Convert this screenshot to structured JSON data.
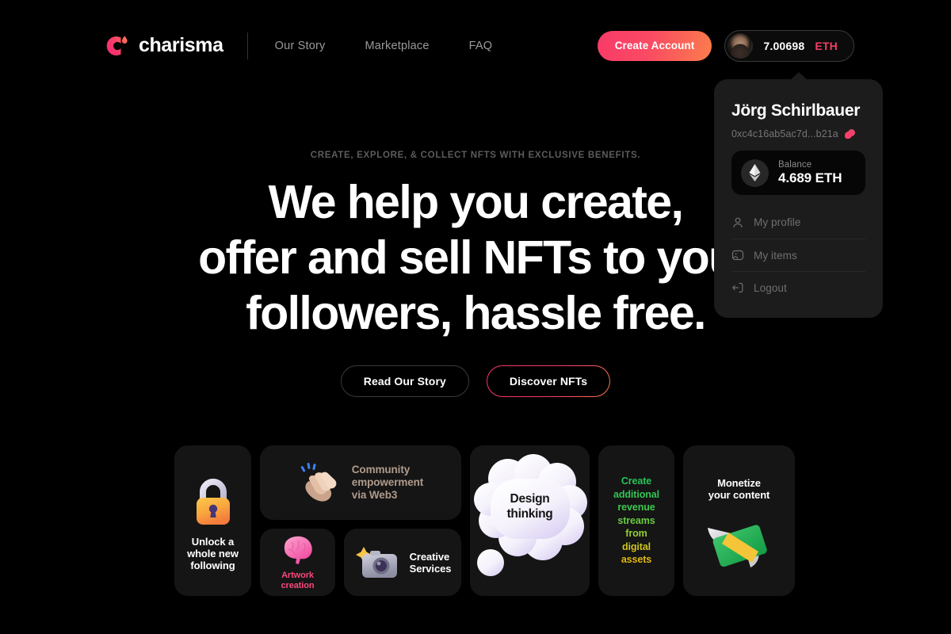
{
  "header": {
    "brand": {
      "name": "charisma",
      "logo_icon": "charisma-c-logo"
    },
    "nav": [
      {
        "label": "Our Story"
      },
      {
        "label": "Marketplace"
      },
      {
        "label": "FAQ"
      }
    ],
    "create_account_label": "Create Account",
    "wallet": {
      "amount": "7.00698",
      "unit": "ETH",
      "avatar_icon": "user-avatar"
    }
  },
  "dropdown": {
    "name": "Jörg Schirlbauer",
    "address": "0xc4c16ab5ac7d...b21a",
    "copy_icon": "copy-icon",
    "balance": {
      "label": "Balance",
      "value": "4.689 ETH",
      "icon": "ethereum-icon"
    },
    "menu": [
      {
        "label": "My profile",
        "icon": "person-icon"
      },
      {
        "label": "My items",
        "icon": "image-icon"
      },
      {
        "label": "Logout",
        "icon": "logout-icon"
      }
    ]
  },
  "hero": {
    "eyebrow": "CREATE, EXPLORE, & COLLECT  NFTS WITH EXCLUSIVE BENEFITS.",
    "headline_line1": "We help you create,",
    "headline_line2": "offer and sell NFTs to your",
    "headline_line3": "followers, hassle free.",
    "primary_cta": "Read Our Story",
    "secondary_cta": "Discover NFTs"
  },
  "cards": {
    "unlock": {
      "title": "Unlock a\nwhole new\nfollowing",
      "icon": "lock-emoji"
    },
    "community": {
      "title": "Community\nempowerment\nvia Web3",
      "icon": "clapping-hands-emoji"
    },
    "artwork": {
      "title": "Artwork\ncreation",
      "icon": "brain-emoji"
    },
    "creative": {
      "title": "Creative\nServices",
      "icon": "camera-with-flash-emoji"
    },
    "design": {
      "title": "Design\nthinking",
      "icon": "thought-bubble"
    },
    "revenue": {
      "title": "Create\nadditional\nrevenue\nstreams\nfrom\ndigital\nassets"
    },
    "monetize": {
      "title": "Monetize\nyour content",
      "icon": "money-with-wings-emoji"
    }
  },
  "colors": {
    "background": "#000000",
    "brand_pink": "#f43f63",
    "brand_orange": "#fb7d4b",
    "panel": "#1c1c1c",
    "card": "#151515",
    "muted_text": "#9a9a9a"
  }
}
